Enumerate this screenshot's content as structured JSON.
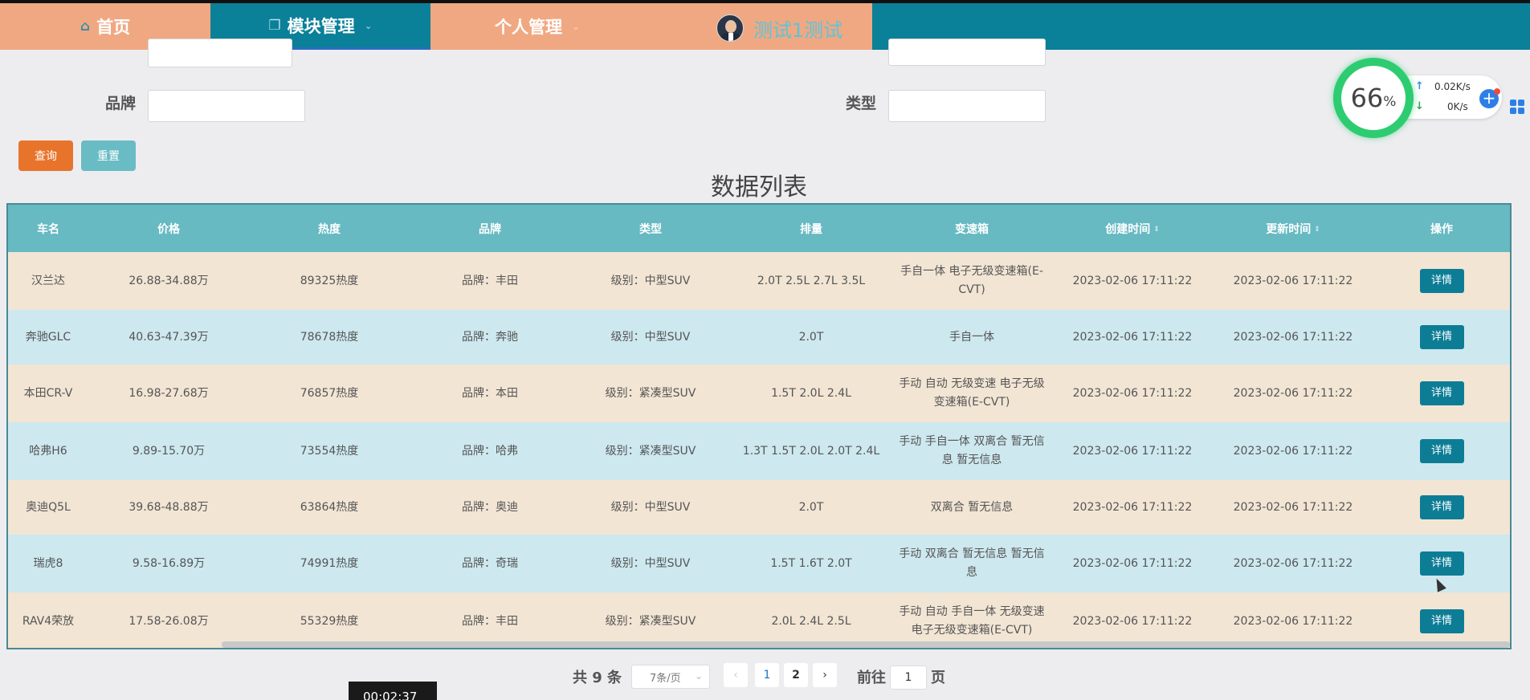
{
  "nav": {
    "home": "首页",
    "module": "模块管理",
    "personal": "个人管理",
    "username": "测试1测试"
  },
  "form": {
    "brand_label": "品牌",
    "type_label": "类型",
    "query_button": "查询",
    "reset_button": "重置"
  },
  "list_title": "数据列表",
  "table": {
    "headers": [
      "车名",
      "价格",
      "热度",
      "品牌",
      "类型",
      "排量",
      "变速箱",
      "创建时间",
      "更新时间",
      "操作"
    ],
    "rows": [
      {
        "name": "汉兰达",
        "price": "26.88-34.88万",
        "heat": "89325热度",
        "brand": "品牌：丰田",
        "type": "级别：中型SUV",
        "displacement": "2.0T 2.5L 2.7L 3.5L",
        "gearbox": "手自一体 电子无级变速箱(E-CVT)",
        "created": "2023-02-06 17:11:22",
        "updated": "2023-02-06 17:11:22",
        "action": "详情"
      },
      {
        "name": "奔驰GLC",
        "price": "40.63-47.39万",
        "heat": "78678热度",
        "brand": "品牌：奔驰",
        "type": "级别：中型SUV",
        "displacement": "2.0T",
        "gearbox": "手自一体",
        "created": "2023-02-06 17:11:22",
        "updated": "2023-02-06 17:11:22",
        "action": "详情"
      },
      {
        "name": "本田CR-V",
        "price": "16.98-27.68万",
        "heat": "76857热度",
        "brand": "品牌：本田",
        "type": "级别：紧凑型SUV",
        "displacement": "1.5T 2.0L 2.4L",
        "gearbox": "手动 自动 无级变速 电子无级变速箱(E-CVT)",
        "created": "2023-02-06 17:11:22",
        "updated": "2023-02-06 17:11:22",
        "action": "详情"
      },
      {
        "name": "哈弗H6",
        "price": "9.89-15.70万",
        "heat": "73554热度",
        "brand": "品牌：哈弗",
        "type": "级别：紧凑型SUV",
        "displacement": "1.3T 1.5T 2.0L 2.0T 2.4L",
        "gearbox": "手动 手自一体 双离合 暂无信息 暂无信息",
        "created": "2023-02-06 17:11:22",
        "updated": "2023-02-06 17:11:22",
        "action": "详情"
      },
      {
        "name": "奥迪Q5L",
        "price": "39.68-48.88万",
        "heat": "63864热度",
        "brand": "品牌：奥迪",
        "type": "级别：中型SUV",
        "displacement": "2.0T",
        "gearbox": "双离合 暂无信息",
        "created": "2023-02-06 17:11:22",
        "updated": "2023-02-06 17:11:22",
        "action": "详情"
      },
      {
        "name": "瑞虎8",
        "price": "9.58-16.89万",
        "heat": "74991热度",
        "brand": "品牌：奇瑞",
        "type": "级别：中型SUV",
        "displacement": "1.5T 1.6T 2.0T",
        "gearbox": "手动 双离合 暂无信息 暂无信息",
        "created": "2023-02-06 17:11:22",
        "updated": "2023-02-06 17:11:22",
        "action": "详情"
      },
      {
        "name": "RAV4荣放",
        "price": "17.58-26.08万",
        "heat": "55329热度",
        "brand": "品牌：丰田",
        "type": "级别：紧凑型SUV",
        "displacement": "2.0L 2.4L 2.5L",
        "gearbox": "手动 自动 手自一体 无级变速 电子无级变速箱(E-CVT)",
        "created": "2023-02-06 17:11:22",
        "updated": "2023-02-06 17:11:22",
        "action": "详情"
      }
    ]
  },
  "pagination": {
    "total": "共 9 条",
    "page_size": "7条/页",
    "page1": "1",
    "page2": "2",
    "goto_label": "前往",
    "goto_value": "1",
    "page_suffix": "页"
  },
  "timer": "00:02:37",
  "speed_widget": {
    "percent": "66",
    "percent_sign": "%",
    "upload": "0.02K/s",
    "download": "0K/s"
  }
}
